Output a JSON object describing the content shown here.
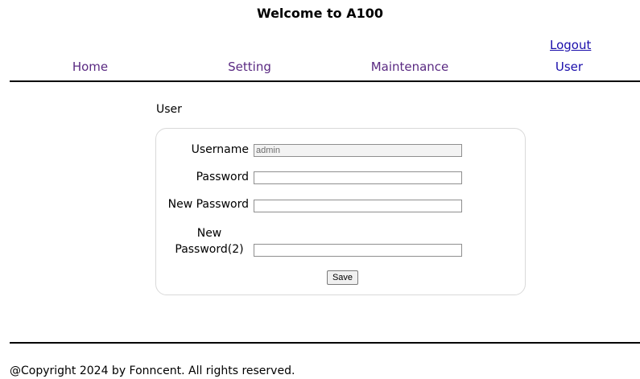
{
  "header": {
    "title": "Welcome to A100",
    "logout_label": "Logout"
  },
  "nav": {
    "items": [
      {
        "label": "Home"
      },
      {
        "label": "Setting"
      },
      {
        "label": "Maintenance"
      },
      {
        "label": "User",
        "active": true
      }
    ]
  },
  "main": {
    "section_title": "User",
    "form": {
      "username_label": "Username",
      "username_value": "admin",
      "password_label": "Password",
      "password_value": "",
      "new_password_label": "New Password",
      "new_password_value": "",
      "new_password2_label": "New Password(2)",
      "new_password2_value": "",
      "save_label": "Save"
    }
  },
  "footer": {
    "copyright": "@Copyright 2024 by Fonncent. All rights reserved."
  },
  "colors": {
    "link": "#1a0dab",
    "visited_link": "#5a2a82",
    "rule": "#000000",
    "form_border": "#d9d9d9"
  }
}
